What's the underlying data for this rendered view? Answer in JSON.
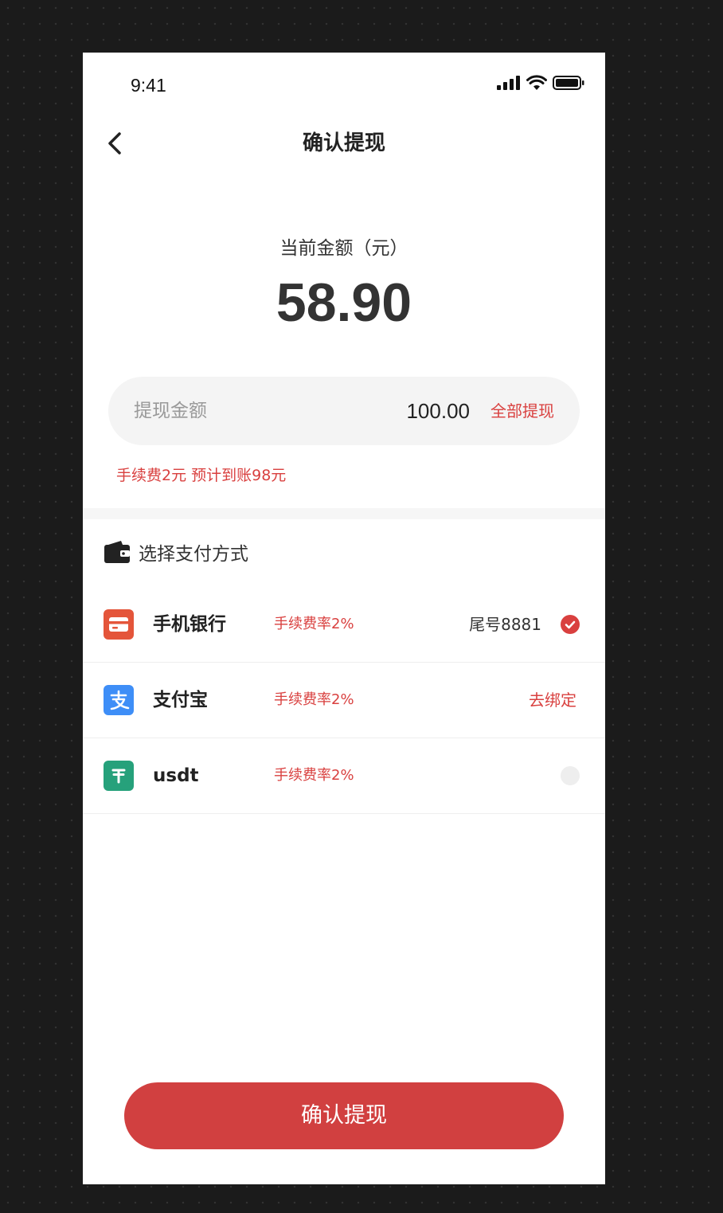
{
  "status_bar": {
    "time": "9:41"
  },
  "header": {
    "title": "确认提现"
  },
  "balance": {
    "label": "当前金额（元）",
    "amount": "58.90"
  },
  "withdraw": {
    "label": "提现金额",
    "value": "100.00",
    "all_label": "全部提现",
    "fee_note": "手续费2元  预计到账98元"
  },
  "payment": {
    "section_title": "选择支付方式",
    "methods": [
      {
        "name": "手机银行",
        "fee": "手续费率2%",
        "tail": "尾号8881",
        "selected": true,
        "icon": "bank-card-icon",
        "icon_color": "#e4553a"
      },
      {
        "name": "支付宝",
        "fee": "手续费率2%",
        "action": "去绑定",
        "icon": "alipay-icon",
        "icon_color": "#3e8ef7"
      },
      {
        "name": "usdt",
        "fee": "手续费率2%",
        "selected": false,
        "icon": "tether-icon",
        "icon_color": "#26a17b"
      }
    ]
  },
  "footer": {
    "confirm_label": "确认提现"
  },
  "colors": {
    "accent": "#d9403f",
    "button": "#d14040"
  }
}
